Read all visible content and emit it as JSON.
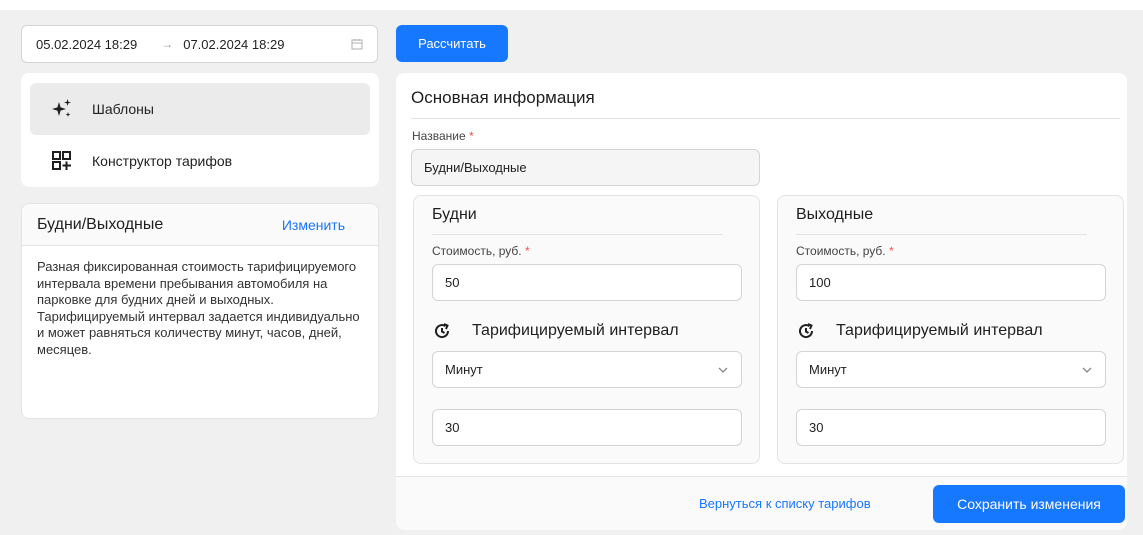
{
  "date_range": {
    "start": "05.02.2024 18:29",
    "arrow": "→",
    "end": "07.02.2024 18:29",
    "icon": "calendar-icon"
  },
  "toolbar": {
    "calculate_label": "Рассчитать"
  },
  "nav": {
    "items": [
      {
        "label": "Шаблоны",
        "icon": "sparkle-icon",
        "active": true
      },
      {
        "label": "Конструктор тарифов",
        "icon": "grid-plus-icon",
        "active": false
      }
    ]
  },
  "template_card": {
    "title": "Будни/Выходные",
    "edit_label": "Изменить",
    "description": "Разная фиксированная стоимость тарифицируемого интервала времени пребывания автомобиля на парковке для будних дней и выходных. Тарифицируемый интервал задается индивидуально и может равняться количеству минут, часов, дней, месяцев."
  },
  "main": {
    "section_title": "Основная информация",
    "name_label": "Название",
    "required_mark": "*",
    "name_value": "Будни/Выходные",
    "weekdays": {
      "title": "Будни",
      "cost_label": "Стоимость, руб.",
      "cost_value": "50",
      "interval_label": "Тарифицируемый интервал",
      "unit_value": "Минут",
      "interval_value": "30"
    },
    "weekends": {
      "title": "Выходные",
      "cost_label": "Стоимость, руб.",
      "cost_value": "100",
      "interval_label": "Тарифицируемый интервал",
      "unit_value": "Минут",
      "interval_value": "30"
    },
    "footer": {
      "back_label": "Вернуться к списку тарифов",
      "save_label": "Сохранить изменения"
    }
  },
  "colors": {
    "primary": "#1677ff",
    "required": "#ff4d4f",
    "page_bg": "#f0f0f0"
  }
}
